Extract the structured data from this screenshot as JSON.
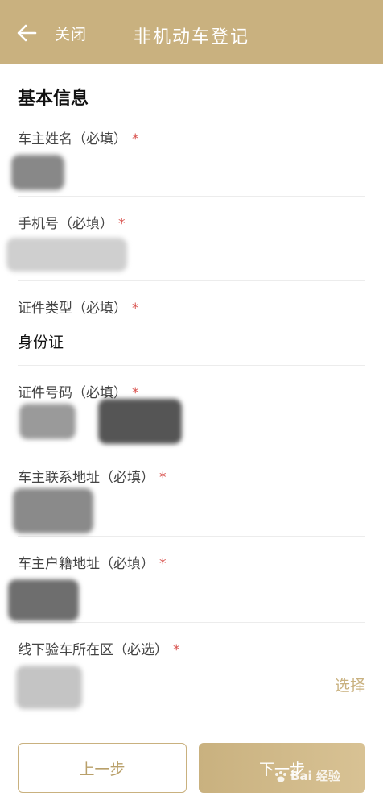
{
  "header": {
    "close_label": "关闭",
    "title": "非机动车登记",
    "background": "#c9b17f"
  },
  "section": {
    "title": "基本信息"
  },
  "fields": [
    {
      "label": "车主姓名（必填）",
      "required_mark": "*"
    },
    {
      "label": "手机号（必填）",
      "required_mark": "*"
    },
    {
      "label": "证件类型（必填）",
      "required_mark": "*",
      "value": "身份证"
    },
    {
      "label": "证件号码（必填）",
      "required_mark": "*"
    },
    {
      "label": "车主联系地址（必填）",
      "required_mark": "*"
    },
    {
      "label": "车主户籍地址（必填）",
      "required_mark": "*"
    },
    {
      "label": "线下验车所在区（必选）",
      "required_mark": "*",
      "select_label": "选择"
    }
  ],
  "footer": {
    "prev_label": "上一步",
    "next_label": "下一步"
  },
  "watermark": "Bai 经验",
  "colors": {
    "accent": "#c9b17f",
    "required": "#d9534f"
  },
  "icons": {
    "back": "arrow-left-icon",
    "watermark_logo": "paw-icon"
  }
}
